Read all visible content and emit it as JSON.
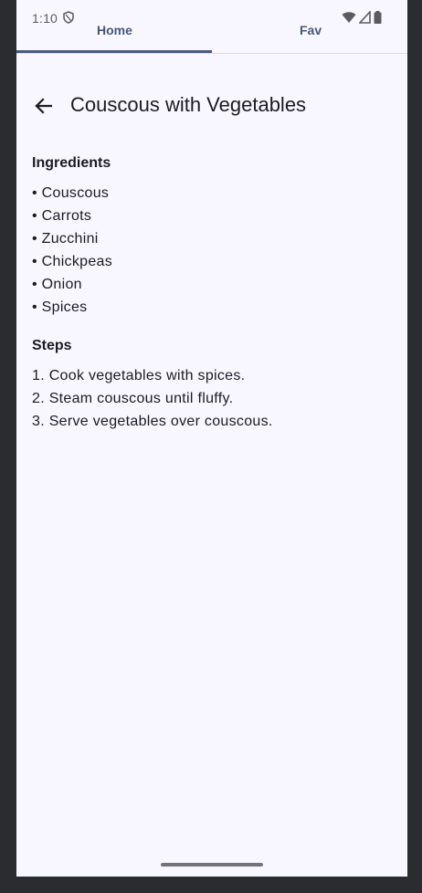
{
  "status_bar": {
    "time": "1:10"
  },
  "tabs": [
    {
      "label": "Home",
      "selected": true
    },
    {
      "label": "Fav",
      "selected": false
    }
  ],
  "recipe": {
    "title": "Couscous with Vegetables",
    "ingredients_heading": "Ingredients",
    "ingredients": [
      "• Couscous",
      "• Carrots",
      "• Zucchini",
      "• Chickpeas",
      "• Onion",
      "• Spices"
    ],
    "steps_heading": "Steps",
    "steps": [
      "1. Cook vegetables with spices.",
      "2. Steam couscous until fluffy.",
      "3. Serve vegetables over couscous."
    ]
  },
  "icons": {
    "back": "arrow-back-icon",
    "status": [
      "shield-icon",
      "wifi-icon",
      "signal-icon",
      "battery-icon"
    ]
  },
  "colors": {
    "accent": "#485a84",
    "background": "#f8f6fe",
    "text": "#1d1b22",
    "frame": "#2b2c30"
  }
}
